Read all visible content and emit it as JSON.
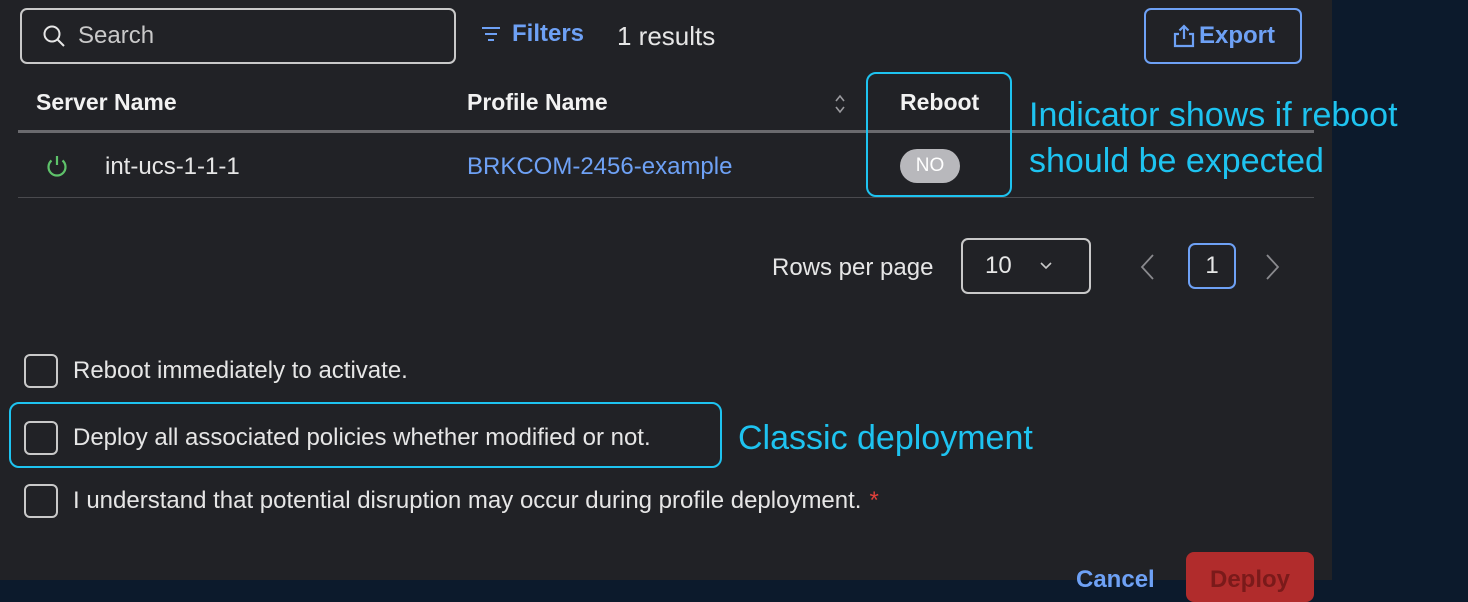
{
  "search": {
    "placeholder": "Search"
  },
  "toolbar": {
    "filters_label": "Filters",
    "results_text": "1 results",
    "export_label": "Export"
  },
  "table": {
    "columns": [
      "Server Name",
      "Profile Name",
      "Reboot"
    ],
    "rows": [
      {
        "server_name": "int-ucs-1-1-1",
        "profile_name": "BRKCOM-2456-example",
        "reboot": "NO",
        "status_icon": "power-icon"
      }
    ]
  },
  "pagination": {
    "rows_per_page_label": "Rows per page",
    "rows_per_page_value": "10",
    "current_page": "1"
  },
  "options": {
    "reboot_immediately": "Reboot immediately to activate.",
    "deploy_all": "Deploy all associated policies whether modified or not.",
    "acknowledge": "I understand that potential disruption may occur during profile deployment.",
    "required_marker": "*"
  },
  "footer": {
    "cancel_label": "Cancel",
    "deploy_label": "Deploy"
  },
  "annotations": {
    "reboot_indicator_line1": "Indicator shows if reboot",
    "reboot_indicator_line2": "should be expected",
    "classic_deployment": "Classic deployment"
  },
  "colors": {
    "panel_bg": "#212226",
    "page_bg": "#0c1a2c",
    "accent": "#6ea1f5",
    "annotation": "#1ec3f0",
    "status_ok": "#5ec26a",
    "danger": "#b12c2c"
  }
}
